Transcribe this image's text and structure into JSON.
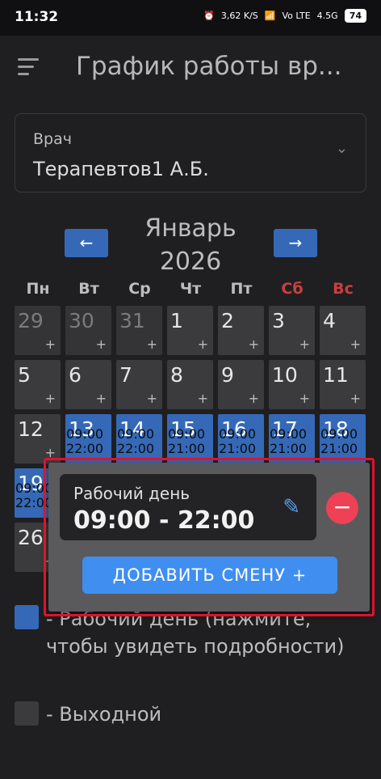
{
  "status": {
    "time": "11:32",
    "speed": "3,62 K/S",
    "net": "Vo LTE",
    "sig": "4.5G",
    "battery": "74"
  },
  "header": {
    "title": "График работы вр..."
  },
  "doctor": {
    "label": "Врач",
    "value": "Терапевтов1 А.Б."
  },
  "calendar": {
    "month": "Январь",
    "year": "2026",
    "weekdays": [
      "Пн",
      "Вт",
      "Ср",
      "Чт",
      "Пт",
      "Сб",
      "Вс"
    ],
    "rows": [
      [
        "29",
        "30",
        "31",
        "1",
        "2",
        "3",
        "4"
      ],
      [
        "5",
        "6",
        "7",
        "8",
        "9",
        "10",
        "11"
      ],
      [
        "12",
        "13",
        "14",
        "15",
        "16",
        "17",
        "18"
      ],
      [
        "19",
        "",
        ""
      ],
      [
        "26"
      ]
    ],
    "work_times": {
      "13": [
        "09:00",
        "22:00"
      ],
      "14": [
        "09:00",
        "22:00"
      ],
      "15": [
        "09:00",
        "21:00"
      ],
      "16": [
        "09:00",
        "21:00"
      ],
      "17": [
        "09:00",
        "21:00"
      ],
      "18": [
        "09:00",
        "21:00"
      ],
      "19": [
        "09:00",
        "22:00"
      ]
    },
    "plus": "+"
  },
  "legend": {
    "work": "- Рабочий день (нажмите, чтобы увидеть подробности)",
    "off": "- Выходной"
  },
  "popup": {
    "shift_label": "Рабочий день",
    "shift_time": "09:00 - 22:00",
    "add_button": "ДОБАВИТЬ СМЕНУ  +"
  },
  "colors": {
    "work": "#3569b8",
    "accent": "#3f8ef0",
    "danger": "#ef4155",
    "highlight": "#e0122a"
  }
}
